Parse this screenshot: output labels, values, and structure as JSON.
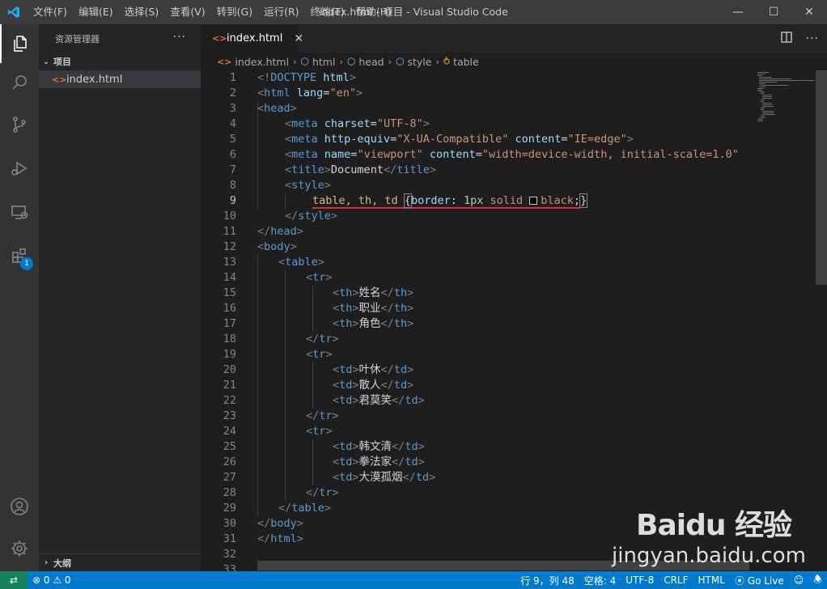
{
  "titlebar": {
    "menu": [
      "文件(F)",
      "编辑(E)",
      "选择(S)",
      "查看(V)",
      "转到(G)",
      "运行(R)",
      "终端(T)",
      "帮助(H)"
    ],
    "title": "index.html - 项目 - Visual Studio Code",
    "minimize": "—",
    "maximize": "☐",
    "close": "✕"
  },
  "activitybar": {
    "extensions_badge": "1"
  },
  "sidebar": {
    "header": "资源管理器",
    "more": "···",
    "section": "项目",
    "file": "index.html",
    "outline": "大纲"
  },
  "editor": {
    "tab_label": "index.html",
    "tab_close": "✕",
    "breadcrumb": [
      "index.html",
      "html",
      "head",
      "style",
      "table"
    ],
    "line_numbers": [
      "1",
      "2",
      "3",
      "4",
      "5",
      "6",
      "7",
      "8",
      "9",
      "10",
      "11",
      "12",
      "13",
      "14",
      "15",
      "16",
      "17",
      "18",
      "19",
      "20",
      "21",
      "22",
      "23",
      "24",
      "25",
      "26",
      "27",
      "28",
      "29",
      "30",
      "31",
      "32",
      "33"
    ],
    "lines": {
      "l1": [
        "<!",
        "DOCTYPE",
        " html",
        ">"
      ],
      "l2": [
        "<",
        "html",
        " lang",
        "=",
        "\"en\"",
        ">"
      ],
      "l3": [
        "<",
        "head",
        ">"
      ],
      "l4": [
        "<",
        "meta",
        " charset",
        "=",
        "\"UTF-8\"",
        ">"
      ],
      "l5": [
        "<",
        "meta",
        " http-equiv",
        "=",
        "\"X-UA-Compatible\"",
        " content",
        "=",
        "\"IE=edge\"",
        ">"
      ],
      "l6": [
        "<",
        "meta",
        " name",
        "=",
        "\"viewport\"",
        " content",
        "=",
        "\"width=device-width, initial-scale=1.0\""
      ],
      "l7": [
        "<",
        "title",
        ">",
        "Document",
        "</",
        "title",
        ">"
      ],
      "l8": [
        "<",
        "style",
        ">"
      ],
      "l9": [
        "table, th, td ",
        "{",
        "border",
        ": ",
        "1px",
        " solid ",
        "black",
        ";",
        "}"
      ],
      "l10": [
        "</",
        "style",
        ">"
      ],
      "l11": [
        "</",
        "head",
        ">"
      ],
      "l12": [
        "<",
        "body",
        ">"
      ],
      "l13": [
        "<",
        "table",
        ">"
      ],
      "l14": [
        "<",
        "tr",
        ">"
      ],
      "l15": [
        "<",
        "th",
        ">",
        "姓名",
        "</",
        "th",
        ">"
      ],
      "l16": [
        "<",
        "th",
        ">",
        "职业",
        "</",
        "th",
        ">"
      ],
      "l17": [
        "<",
        "th",
        ">",
        "角色",
        "</",
        "th",
        ">"
      ],
      "l18": [
        "</",
        "tr",
        ">"
      ],
      "l19": [
        "<",
        "tr",
        ">"
      ],
      "l20": [
        "<",
        "td",
        ">",
        "叶休",
        "</",
        "td",
        ">"
      ],
      "l21": [
        "<",
        "td",
        ">",
        "散人",
        "</",
        "td",
        ">"
      ],
      "l22": [
        "<",
        "td",
        ">",
        "君莫笑",
        "</",
        "td",
        ">"
      ],
      "l23": [
        "</",
        "tr",
        ">"
      ],
      "l24": [
        "<",
        "tr",
        ">"
      ],
      "l25": [
        "<",
        "td",
        ">",
        "韩文清",
        "</",
        "td",
        ">"
      ],
      "l26": [
        "<",
        "td",
        ">",
        "拳法家",
        "</",
        "td",
        ">"
      ],
      "l27": [
        "<",
        "td",
        ">",
        "大漠孤烟",
        "</",
        "td",
        ">"
      ],
      "l28": [
        "</",
        "tr",
        ">"
      ],
      "l29": [
        "</",
        "table",
        ">"
      ],
      "l30": [
        "</",
        "body",
        ">"
      ],
      "l31": [
        "</",
        "html",
        ">"
      ]
    }
  },
  "statusbar": {
    "remote": "⇄",
    "problems": "⊗ 0 ⚠ 0",
    "position": "行 9，列 48",
    "spaces": "空格: 4",
    "encoding": "UTF-8",
    "eol": "CRLF",
    "language": "HTML",
    "golive": "Go Live"
  },
  "watermark": {
    "brand": "Baidu 经验",
    "sub": "jingyan.baidu.com"
  }
}
